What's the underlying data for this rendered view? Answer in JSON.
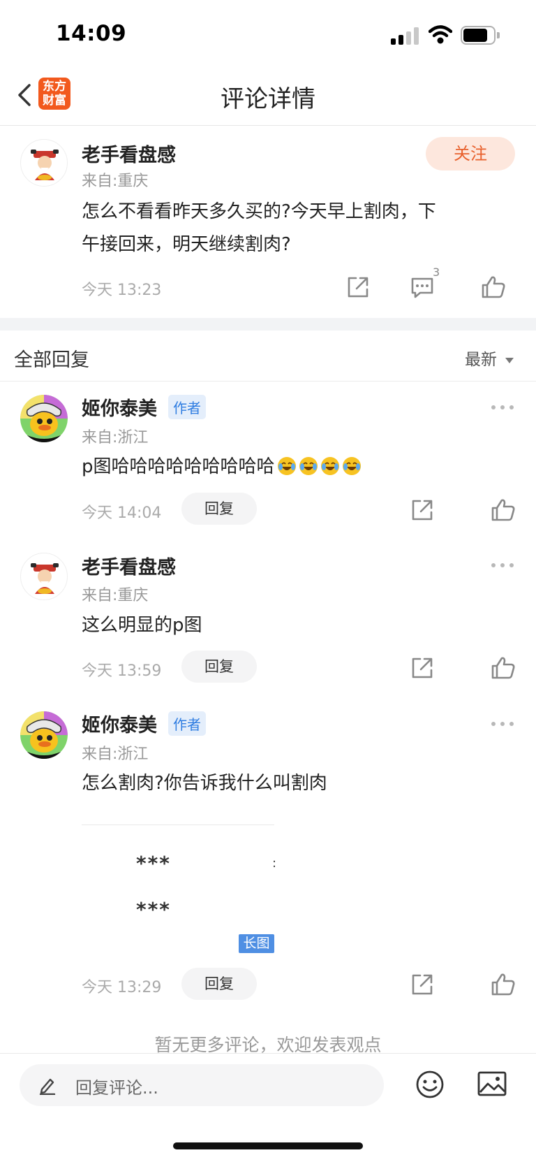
{
  "status_bar": {
    "time": "14:09"
  },
  "nav": {
    "title": "评论详情",
    "logo_line1": "东方",
    "logo_line2": "财富"
  },
  "main_comment": {
    "username": "老手看盘感",
    "location": "来自:重庆",
    "follow_label": "关注",
    "text_line1": "怎么不看看昨天多久买的?今天早上割肉，下",
    "text_line2": "午接回来，明天继续割肉?",
    "time": "今天 13:23",
    "reply_count": "3"
  },
  "replies_section": {
    "title": "全部回复",
    "sort_label": "最新"
  },
  "replies": [
    {
      "username": "姬你泰美",
      "author_tag": "作者",
      "location": "来自:浙江",
      "text": "p图哈哈哈哈哈哈哈哈哈",
      "emoji_count": 4,
      "time": "今天 14:04",
      "reply_label": "回复"
    },
    {
      "username": "老手看盘感",
      "location": "来自:重庆",
      "text": "这么明显的p图",
      "time": "今天 13:59",
      "reply_label": "回复"
    },
    {
      "username": "姬你泰美",
      "author_tag": "作者",
      "location": "来自:浙江",
      "text": "怎么割肉?你告诉我什么叫割肉",
      "image_line1": "***",
      "image_line2": "***",
      "image_tag": "长图",
      "time": "今天 13:29",
      "reply_label": "回复"
    }
  ],
  "footer": {
    "no_more": "暂无更多评论，欢迎发表观点"
  },
  "bottom_bar": {
    "input_placeholder": "回复评论..."
  },
  "colors": {
    "accent_orange": "#e8602c",
    "author_blue": "#2f7de1",
    "logo_orange": "#f2591d"
  }
}
